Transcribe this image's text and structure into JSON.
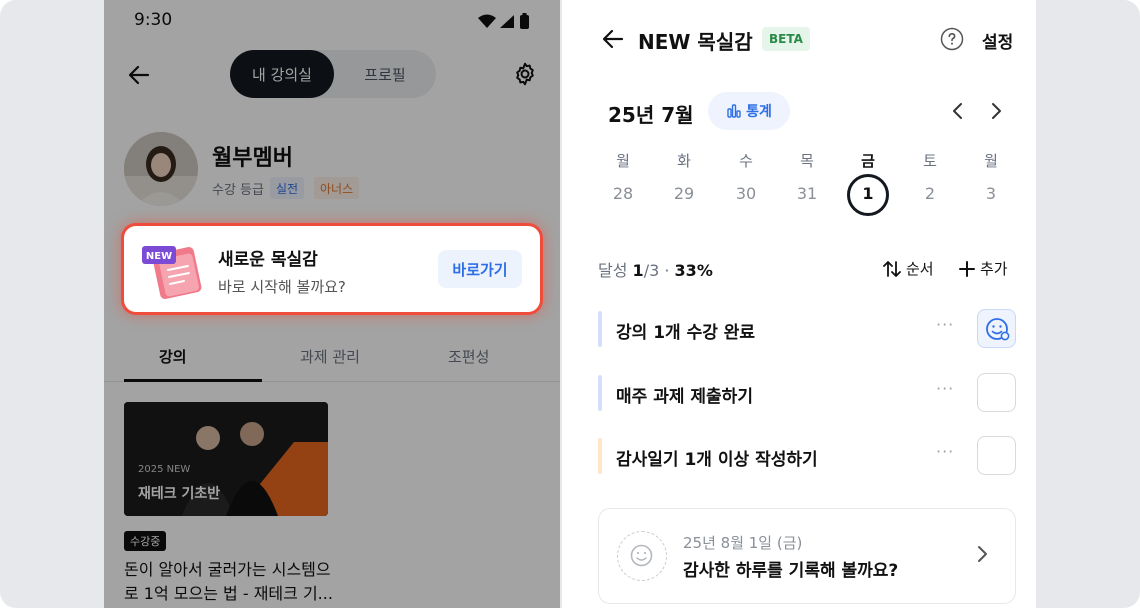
{
  "phone": {
    "status_time": "9:30",
    "segment": {
      "active": "내 강의실",
      "inactive": "프로필"
    },
    "profile": {
      "name": "월부멤버",
      "grade_label": "수강 등급",
      "chips": [
        "실전",
        "아너스"
      ]
    },
    "promo": {
      "badge": "NEW",
      "title": "새로운 목실감",
      "subtitle": "바로 시작해 볼까요?",
      "button": "바로가기"
    },
    "tabs": [
      "강의",
      "과제 관리",
      "조편성"
    ],
    "course": {
      "thumb_badge": "2025 NEW",
      "thumb_title": "재테크 기초반",
      "status": "수강중",
      "title": "돈이 알아서 굴러가는 시스템으\n로 1억 모으는 법 - 재테크 기..."
    }
  },
  "panel": {
    "title": "NEW 목실감",
    "badge": "BETA",
    "settings": "설정",
    "month": "25년 7월",
    "stats_button": "통계",
    "week": [
      {
        "name": "월",
        "num": "28"
      },
      {
        "name": "화",
        "num": "29"
      },
      {
        "name": "수",
        "num": "30"
      },
      {
        "name": "목",
        "num": "31"
      },
      {
        "name": "금",
        "num": "1",
        "selected": true
      },
      {
        "name": "토",
        "num": "2"
      },
      {
        "name": "월",
        "num": "3"
      }
    ],
    "achievement": {
      "label": "달성",
      "done": "1",
      "total": "/3",
      "sep": "·",
      "percent": "33%"
    },
    "sort_label": "순서",
    "add_label": "추가",
    "tasks": [
      {
        "text": "강의 1개 수강 완료",
        "more": "···",
        "checked": true,
        "bar_color": "#d4e0fb"
      },
      {
        "text": "매주 과제 제출하기",
        "more": "···",
        "checked": false,
        "bar_color": "#d4e0fb"
      },
      {
        "text": "감사일기 1개 이상 작성하기",
        "more": "···",
        "checked": false,
        "bar_color": "#fde5c6"
      }
    ],
    "diary": {
      "date": "25년 8월 1일 (금)",
      "text": "감사한 하루를 기록해 볼까요?"
    }
  },
  "colors": {
    "accent_blue": "#2f6fe6",
    "highlight_red": "#ef4c3b",
    "beta_green": "#2a8a47",
    "dark": "#14181f"
  },
  "icons": [
    "back-arrow-icon",
    "gear-icon",
    "help-icon",
    "chart-icon",
    "chevron-left-icon",
    "chevron-right-icon",
    "sort-icon",
    "plus-icon",
    "smile-check-icon",
    "smile-icon",
    "chevron-right-icon"
  ]
}
